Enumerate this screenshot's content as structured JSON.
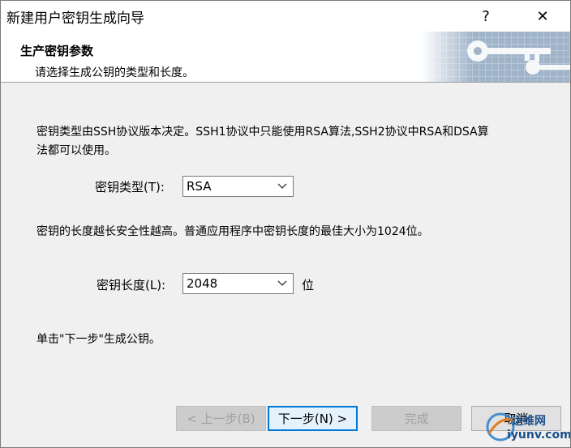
{
  "window": {
    "title": "新建用户密钥生成向导",
    "help_label": "?",
    "close_label": "✕"
  },
  "header": {
    "title": "生产密钥参数",
    "subtitle": "请选择生成公钥的类型和长度。"
  },
  "body": {
    "description_line1": "密钥类型由SSH协议版本决定。SSH1协议中只能使用RSA算法,SSH2协议中RSA和DSA算",
    "description_line2": "法都可以使用。",
    "key_type_label": "密钥类型(T):",
    "key_type_value": "RSA",
    "length_description": "密钥的长度越长安全性越高。普通应用程序中密钥长度的最佳大小为1024位。",
    "key_length_label": "密钥长度(L):",
    "key_length_value": "2048",
    "key_length_unit": "位",
    "instruction": "单击\"下一步\"生成公钥。"
  },
  "buttons": {
    "back": "< 上一步(B)",
    "next": "下一步(N) >",
    "finish": "完成",
    "cancel": "取消"
  },
  "watermark": {
    "line1": "运维网",
    "line2": "iyunv.com"
  },
  "colors": {
    "accent": "#0078d7",
    "header_art": "#7f98b4",
    "watermark": "#1b4f8a"
  }
}
